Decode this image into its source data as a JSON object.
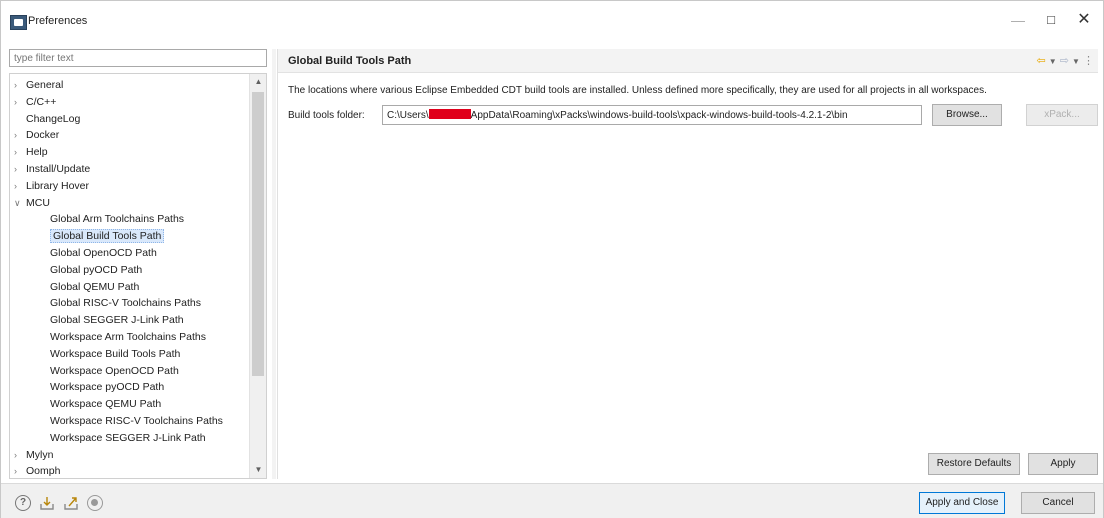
{
  "window": {
    "title": "Preferences"
  },
  "left": {
    "filter_placeholder": "type filter text",
    "tree": [
      {
        "label": "General",
        "arrow": ">"
      },
      {
        "label": "C/C++",
        "arrow": ">"
      },
      {
        "label": "ChangeLog",
        "arrow": ""
      },
      {
        "label": "Docker",
        "arrow": ">"
      },
      {
        "label": "Help",
        "arrow": ">"
      },
      {
        "label": "Install/Update",
        "arrow": ">"
      },
      {
        "label": "Library Hover",
        "arrow": ">"
      },
      {
        "label": "MCU",
        "arrow": "v"
      },
      {
        "label": "Global Arm Toolchains Paths",
        "arrow": ""
      },
      {
        "label": "Global Build Tools Path",
        "arrow": "",
        "selected": true
      },
      {
        "label": "Global OpenOCD Path",
        "arrow": ""
      },
      {
        "label": "Global pyOCD Path",
        "arrow": ""
      },
      {
        "label": "Global QEMU Path",
        "arrow": ""
      },
      {
        "label": "Global RISC-V Toolchains Paths",
        "arrow": ""
      },
      {
        "label": "Global SEGGER J-Link Path",
        "arrow": ""
      },
      {
        "label": "Workspace Arm Toolchains Paths",
        "arrow": ""
      },
      {
        "label": "Workspace Build Tools Path",
        "arrow": ""
      },
      {
        "label": "Workspace OpenOCD Path",
        "arrow": ""
      },
      {
        "label": "Workspace pyOCD Path",
        "arrow": ""
      },
      {
        "label": "Workspace QEMU Path",
        "arrow": ""
      },
      {
        "label": "Workspace RISC-V Toolchains Paths",
        "arrow": ""
      },
      {
        "label": "Workspace SEGGER J-Link Path",
        "arrow": ""
      },
      {
        "label": "Mylyn",
        "arrow": ">"
      },
      {
        "label": "Oomph",
        "arrow": ">"
      }
    ]
  },
  "page": {
    "title": "Global Build Tools Path",
    "description": "The locations where various Eclipse Embedded CDT build tools are installed. Unless defined more specifically, they are used for all projects in all workspaces.",
    "field_label": "Build tools folder:",
    "path_prefix": "C:\\Users\\",
    "path_suffix": "AppData\\Roaming\\xPacks\\windows-build-tools\\xpack-windows-build-tools-4.2.1-2\\bin",
    "browse_label": "Browse...",
    "xpack_label": "xPack...",
    "restore_label": "Restore Defaults",
    "apply_label": "Apply"
  },
  "bottom": {
    "help_glyph": "?",
    "apply_close_label": "Apply and Close",
    "cancel_label": "Cancel"
  },
  "colors": {
    "selection": "#d9e8fb",
    "redaction": "#e0001b",
    "primary_border": "#0078d7"
  }
}
